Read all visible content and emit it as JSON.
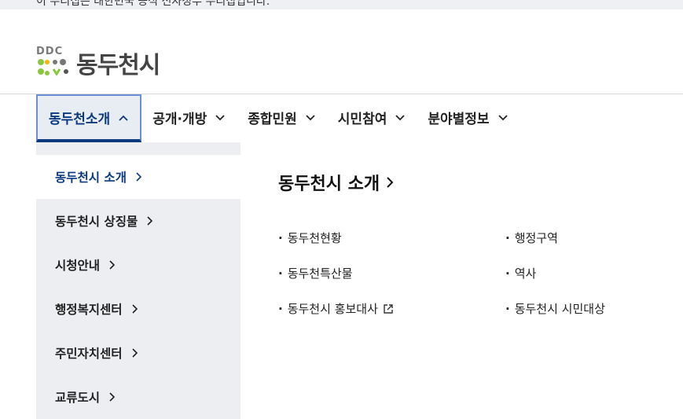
{
  "topbar": {
    "text": "이 누리집은 대한민국 공식 전자정부 누리집입니다."
  },
  "logo": {
    "mark_text": "DDC",
    "name": "동두천시"
  },
  "gnb": {
    "items": [
      {
        "label": "동두천소개",
        "active": true
      },
      {
        "label": "공개·개방",
        "active": false
      },
      {
        "label": "종합민원",
        "active": false
      },
      {
        "label": "시민참여",
        "active": false
      },
      {
        "label": "분야별정보",
        "active": false
      }
    ]
  },
  "lnb": {
    "items": [
      {
        "label": "동두천시 소개",
        "active": true
      },
      {
        "label": "동두천시 상징물",
        "active": false
      },
      {
        "label": "시청안내",
        "active": false
      },
      {
        "label": "행정복지센터",
        "active": false
      },
      {
        "label": "주민자치센터",
        "active": false
      },
      {
        "label": "교류도시",
        "active": false
      }
    ]
  },
  "content": {
    "title": "동두천시 소개",
    "links": [
      {
        "label": "동두천현황",
        "external": false
      },
      {
        "label": "행정구역",
        "external": false
      },
      {
        "label": "동두천특산물",
        "external": false
      },
      {
        "label": "역사",
        "external": false
      },
      {
        "label": "동두천시 홍보대사",
        "external": true
      },
      {
        "label": "동두천시 시민대상",
        "external": false
      }
    ],
    "bullet": "·"
  },
  "colors": {
    "accent": "#0b3a7e",
    "active_border": "#6b8fd6",
    "lnb_bg": "#eceef2"
  },
  "icons": {
    "gnb_chevron": "chevron-down-icon",
    "gnb_active_chevron": "chevron-up-icon",
    "lnb_arrow": "chevron-right-icon",
    "external": "external-link-icon"
  }
}
